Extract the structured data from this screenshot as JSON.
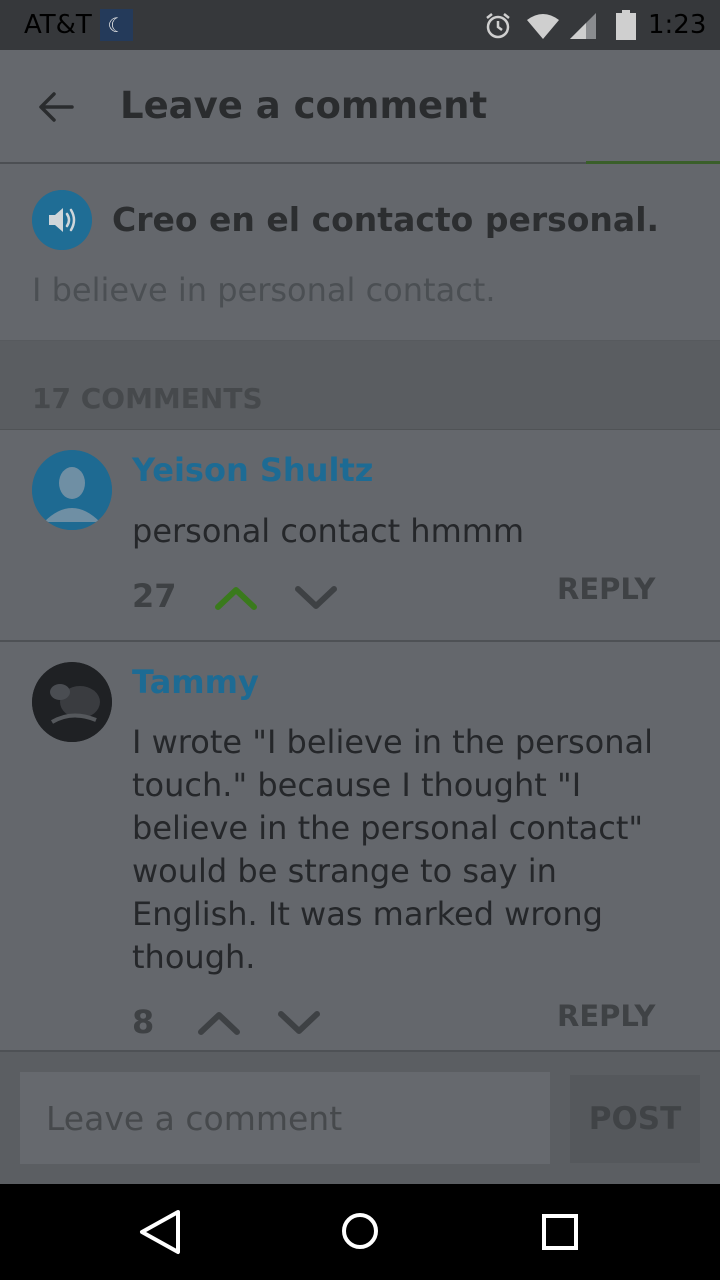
{
  "status_bar": {
    "carrier": "AT&T",
    "notification_icon": "moon-icon",
    "icons": [
      "alarm-icon",
      "wifi-icon",
      "signal-icon",
      "battery-icon"
    ],
    "time": "1:23"
  },
  "app_bar": {
    "back_icon": "arrow-back-icon",
    "title": "Leave a comment"
  },
  "sentence": {
    "speaker_icon": "speaker-icon",
    "text": "Creo en el contacto personal.",
    "translation": "I believe in personal contact."
  },
  "comments": {
    "header": "17 COMMENTS",
    "items": [
      {
        "author": "Yeison Shultz",
        "body": "personal contact hmmm",
        "votes": "27",
        "upvoted": true,
        "reply_label": "REPLY"
      },
      {
        "author": "Tammy",
        "body": "I wrote \"I believe in the personal touch.\" because I thought \"I believe in the personal contact\" would be strange to say in English. It was marked wrong though.",
        "votes": "8",
        "upvoted": false,
        "reply_label": "REPLY"
      }
    ]
  },
  "composer": {
    "placeholder": "Leave a comment",
    "value": "",
    "post_label": "POST"
  },
  "nav_bar": {
    "buttons": [
      "nav-back-icon",
      "nav-home-icon",
      "nav-recents-icon"
    ]
  },
  "colors": {
    "accent_blue": "#1d6b94",
    "upvote_green": "#3a7a1c",
    "scrim_gray": "#5f6368"
  }
}
